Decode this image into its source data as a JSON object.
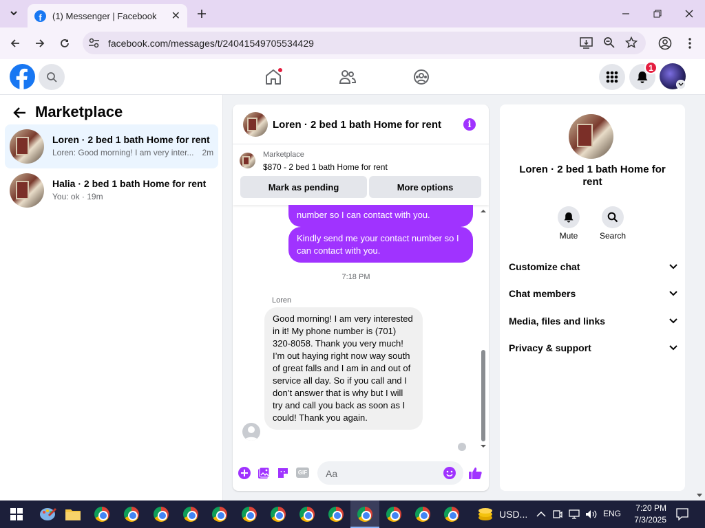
{
  "browser": {
    "tab_title": "(1) Messenger | Facebook",
    "url": "facebook.com/messages/t/24041549705534429"
  },
  "header": {
    "notification_count": "1"
  },
  "left": {
    "title": "Marketplace",
    "conversations": [
      {
        "name": "Loren · 2 bed 1 bath Home for rent",
        "preview": "Loren: Good morning! I am very inter...",
        "time": "2m"
      },
      {
        "name": "Halia · 2 bed 1 bath Home for rent",
        "preview": "You: ok · 19m",
        "time": ""
      }
    ]
  },
  "chat": {
    "title": "Loren · 2 bed 1 bath Home for rent",
    "listing_source": "Marketplace",
    "listing": "$870 - 2 bed 1 bath Home for rent",
    "mark_pending": "Mark as pending",
    "more_options": "More options",
    "messages_out": [
      "number so I can contact with you.",
      "Kindly  send me your contact number so I can contact with you."
    ],
    "timestamp": "7:18 PM",
    "sender": "Loren",
    "message_in": "Good morning! I am very interested in it! My phone number is (701) 320-8058. Thank you very much! I’m out haying right now way south of great falls and I am in and out of service all day. So if you call and I don’t answer that is why but I will try and call you back as soon as I could! Thank you again.",
    "composer_placeholder": "Aa"
  },
  "right": {
    "name": "Loren · 2 bed 1 bath Home for rent",
    "mute": "Mute",
    "search": "Search",
    "sections": [
      "Customize chat",
      "Chat members",
      "Media, files and links",
      "Privacy & support"
    ]
  },
  "taskbar": {
    "currency": "USD...",
    "lang": "ENG",
    "time": "7:20 PM",
    "date": "7/3/2025"
  },
  "colors": {
    "accent": "#a033ff",
    "facebook_blue": "#1877f2"
  }
}
